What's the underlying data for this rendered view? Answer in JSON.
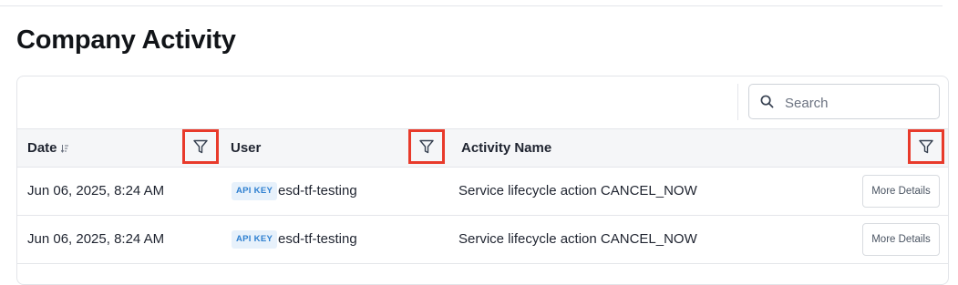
{
  "page": {
    "title": "Company Activity"
  },
  "search": {
    "placeholder": "Search",
    "value": ""
  },
  "columns": [
    {
      "label": "Date",
      "sortable": true
    },
    {
      "label": "User"
    },
    {
      "label": "Activity Name"
    }
  ],
  "rows": [
    {
      "date": "Jun 06, 2025, 8:24 AM",
      "badge": "API KEY",
      "user": "esd-tf-testing",
      "activity": "Service lifecycle action CANCEL_NOW",
      "action_label": "More Details"
    },
    {
      "date": "Jun 06, 2025, 8:24 AM",
      "badge": "API KEY",
      "user": "esd-tf-testing",
      "activity": "Service lifecycle action CANCEL_NOW",
      "action_label": "More Details"
    }
  ],
  "colors": {
    "highlight": "#e83a2b",
    "badge_bg": "#e7f1fb",
    "badge_text": "#2d7fd0",
    "header_bg": "#f5f6f8"
  },
  "icons": {
    "search": "search-icon",
    "filter": "filter-icon",
    "sort": "sort-icon"
  }
}
